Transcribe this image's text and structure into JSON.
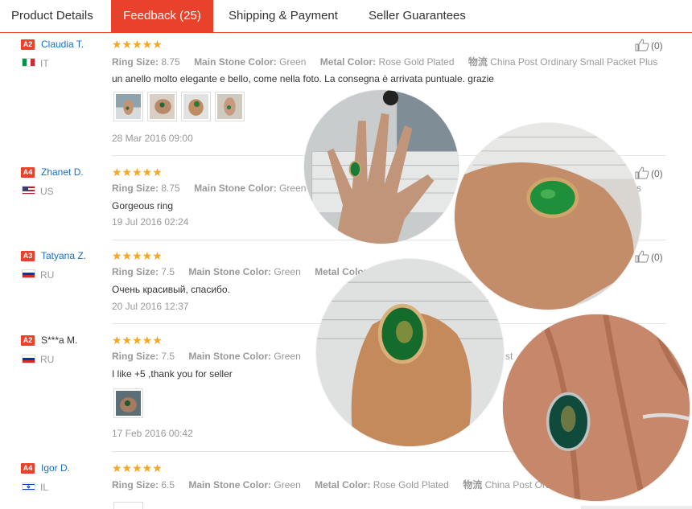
{
  "tabs": [
    {
      "label": "Product Details"
    },
    {
      "label": "Feedback (25)"
    },
    {
      "label": "Shipping & Payment"
    },
    {
      "label": "Seller Guarantees"
    }
  ],
  "labels": {
    "ring_size": "Ring Size:",
    "stone": "Main Stone Color:",
    "metal": "Metal Color:",
    "shipping": "物流"
  },
  "reviews": [
    {
      "badge": "A2",
      "name": "Claudia T.",
      "country": "IT",
      "stars": "★★★★★",
      "ring_size": "8.75",
      "stone": "Green",
      "metal": "Rose Gold Plated",
      "shipping": "China Post Ordinary Small Packet Plus",
      "text": "un anello molto elegante e bello, come nella foto. La consegna è arrivata puntuale. grazie",
      "date": "28 Mar 2016 09:00",
      "likes": "(0)"
    },
    {
      "badge": "A4",
      "name": "Zhanet D.",
      "country": "US",
      "stars": "★★★★★",
      "ring_size": "8.75",
      "stone": "Green",
      "text": "Gorgeous ring",
      "date": "19 Jul 2016 02:24",
      "likes": "(0)",
      "shipping_tail": "s"
    },
    {
      "badge": "A3",
      "name": "Tatyana Z.",
      "country": "RU",
      "stars": "★★★★★",
      "ring_size": "7.5",
      "stone": "Green",
      "metal": "Metal Color:",
      "text": "Очень красивый, спасибо.",
      "date": "20 Jul 2016 12:37",
      "likes": "(0)"
    },
    {
      "badge": "A2",
      "name": "S***a M.",
      "country": "RU",
      "stars": "★★★★★",
      "ring_size": "7.5",
      "stone": "Green",
      "text": "I like +5 ,thank you for seller",
      "date": "17 Feb 2016 00:42",
      "shipping_tail": "st"
    },
    {
      "badge": "A4",
      "name": "Igor D.",
      "country": "IL",
      "stars": "★★★★★",
      "ring_size": "6.5",
      "stone": "Green",
      "metal": "Rose Gold Plated",
      "shipping": "China Post Ordi"
    }
  ],
  "colors": {
    "accent": "#e8412c",
    "link": "#1a6fc4",
    "star": "#f5a623",
    "emerald": "#1f8a3a"
  }
}
